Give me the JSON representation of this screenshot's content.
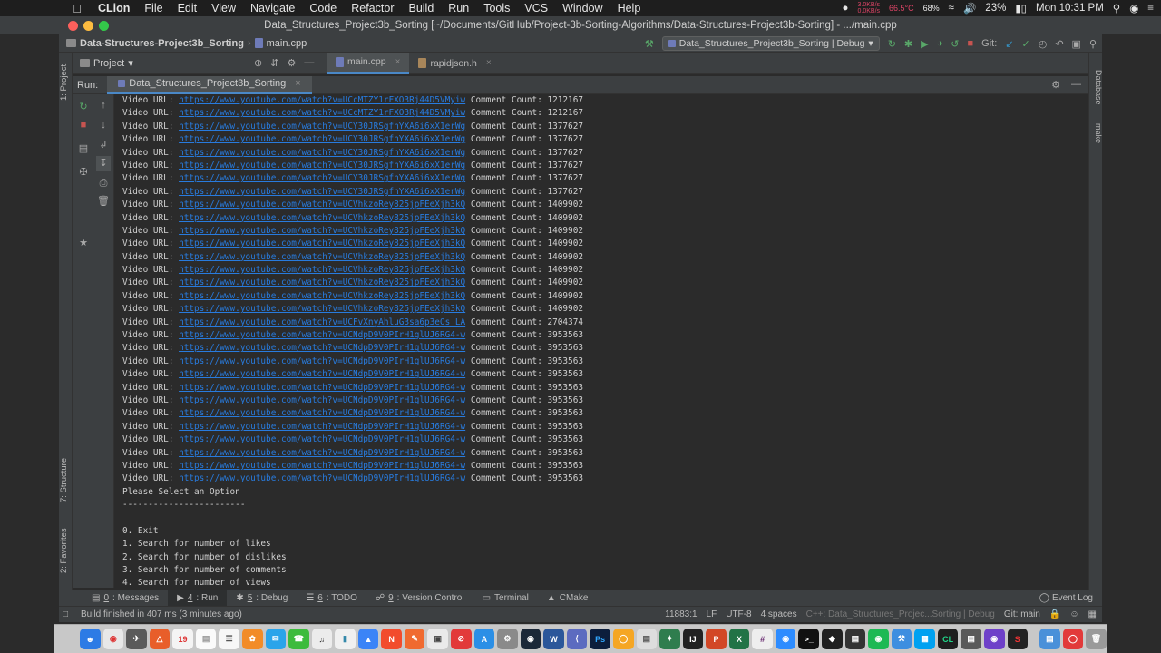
{
  "menubar": {
    "app": "CLion",
    "items": [
      "File",
      "Edit",
      "View",
      "Navigate",
      "Code",
      "Refactor",
      "Build",
      "Run",
      "Tools",
      "VCS",
      "Window",
      "Help"
    ],
    "net_tx": "3.0KB/s",
    "net_rx": "0.0KB/s",
    "cpu_temp": "66.5°C",
    "cpu_pct": "68%",
    "battery": "23%",
    "clock": "Mon 10:31 PM"
  },
  "window": {
    "title": "Data_Structures_Project3b_Sorting [~/Documents/GitHub/Project-3b-Sorting-Algorithms/Data-Structures-Project3b-Sorting] - .../main.cpp"
  },
  "navbar": {
    "project": "Data-Structures-Project3b_Sorting",
    "file": "main.cpp",
    "run_config": "Data_Structures_Project3b_Sorting | Debug",
    "git_label": "Git:"
  },
  "project_panel": {
    "label": "Project"
  },
  "editor_tabs": [
    {
      "label": "main.cpp",
      "active": true
    },
    {
      "label": "rapidjson.h",
      "active": false
    }
  ],
  "run_panel": {
    "label": "Run:",
    "tab": "Data_Structures_Project3b_Sorting"
  },
  "console": {
    "url_prefix": "Video URL: ",
    "count_prefix": " Comment Count: ",
    "rows": [
      {
        "url": "https://www.youtube.com/watch?v=UCcMTZY1rFXO3Rj44D5VMyiw",
        "count": "1212167"
      },
      {
        "url": "https://www.youtube.com/watch?v=UCcMTZY1rFXO3Rj44D5VMyiw",
        "count": "1212167"
      },
      {
        "url": "https://www.youtube.com/watch?v=UCY30JRSgfhYXA6i6xX1erWg",
        "count": "1377627"
      },
      {
        "url": "https://www.youtube.com/watch?v=UCY30JRSgfhYXA6i6xX1erWg",
        "count": "1377627"
      },
      {
        "url": "https://www.youtube.com/watch?v=UCY30JRSgfhYXA6i6xX1erWg",
        "count": "1377627"
      },
      {
        "url": "https://www.youtube.com/watch?v=UCY30JRSgfhYXA6i6xX1erWg",
        "count": "1377627"
      },
      {
        "url": "https://www.youtube.com/watch?v=UCY30JRSgfhYXA6i6xX1erWg",
        "count": "1377627"
      },
      {
        "url": "https://www.youtube.com/watch?v=UCY30JRSgfhYXA6i6xX1erWg",
        "count": "1377627"
      },
      {
        "url": "https://www.youtube.com/watch?v=UCVhkzoRey825jpFEeXjh3kQ",
        "count": "1409902"
      },
      {
        "url": "https://www.youtube.com/watch?v=UCVhkzoRey825jpFEeXjh3kQ",
        "count": "1409902"
      },
      {
        "url": "https://www.youtube.com/watch?v=UCVhkzoRey825jpFEeXjh3kQ",
        "count": "1409902"
      },
      {
        "url": "https://www.youtube.com/watch?v=UCVhkzoRey825jpFEeXjh3kQ",
        "count": "1409902"
      },
      {
        "url": "https://www.youtube.com/watch?v=UCVhkzoRey825jpFEeXjh3kQ",
        "count": "1409902"
      },
      {
        "url": "https://www.youtube.com/watch?v=UCVhkzoRey825jpFEeXjh3kQ",
        "count": "1409902"
      },
      {
        "url": "https://www.youtube.com/watch?v=UCVhkzoRey825jpFEeXjh3kQ",
        "count": "1409902"
      },
      {
        "url": "https://www.youtube.com/watch?v=UCVhkzoRey825jpFEeXjh3kQ",
        "count": "1409902"
      },
      {
        "url": "https://www.youtube.com/watch?v=UCVhkzoRey825jpFEeXjh3kQ",
        "count": "1409902"
      },
      {
        "url": "https://www.youtube.com/watch?v=UCFvXnyAhluG3sa6p3eOs_LA",
        "count": "2704374"
      },
      {
        "url": "https://www.youtube.com/watch?v=UCNdpD9V0PIrH1glUJ6RG4-w",
        "count": "3953563"
      },
      {
        "url": "https://www.youtube.com/watch?v=UCNdpD9V0PIrH1glUJ6RG4-w",
        "count": "3953563"
      },
      {
        "url": "https://www.youtube.com/watch?v=UCNdpD9V0PIrH1glUJ6RG4-w",
        "count": "3953563"
      },
      {
        "url": "https://www.youtube.com/watch?v=UCNdpD9V0PIrH1glUJ6RG4-w",
        "count": "3953563"
      },
      {
        "url": "https://www.youtube.com/watch?v=UCNdpD9V0PIrH1glUJ6RG4-w",
        "count": "3953563"
      },
      {
        "url": "https://www.youtube.com/watch?v=UCNdpD9V0PIrH1glUJ6RG4-w",
        "count": "3953563"
      },
      {
        "url": "https://www.youtube.com/watch?v=UCNdpD9V0PIrH1glUJ6RG4-w",
        "count": "3953563"
      },
      {
        "url": "https://www.youtube.com/watch?v=UCNdpD9V0PIrH1glUJ6RG4-w",
        "count": "3953563"
      },
      {
        "url": "https://www.youtube.com/watch?v=UCNdpD9V0PIrH1glUJ6RG4-w",
        "count": "3953563"
      },
      {
        "url": "https://www.youtube.com/watch?v=UCNdpD9V0PIrH1glUJ6RG4-w",
        "count": "3953563"
      },
      {
        "url": "https://www.youtube.com/watch?v=UCNdpD9V0PIrH1glUJ6RG4-w",
        "count": "3953563"
      },
      {
        "url": "https://www.youtube.com/watch?v=UCNdpD9V0PIrH1glUJ6RG4-w",
        "count": "3953563"
      }
    ],
    "menu_title": "Please Select an Option",
    "separator": "------------------------",
    "options": [
      "0. Exit",
      "1. Search for number of likes",
      "2. Search for number of dislikes",
      "3. Search for number of comments",
      "4. Search for number of views"
    ]
  },
  "bottom_tabs": [
    {
      "num": "0",
      "label": ": Messages",
      "icon": "messages-icon"
    },
    {
      "num": "4",
      "label": ": Run",
      "icon": "run-icon",
      "active": true
    },
    {
      "num": "5",
      "label": ": Debug",
      "icon": "debug-icon"
    },
    {
      "num": "6",
      "label": ": TODO",
      "icon": "todo-icon"
    },
    {
      "num": "9",
      "label": ": Version Control",
      "icon": "vcs-icon"
    },
    {
      "num": "",
      "label": "Terminal",
      "icon": "terminal-icon"
    },
    {
      "num": "",
      "label": "CMake",
      "icon": "cmake-icon"
    }
  ],
  "event_log": "Event Log",
  "status": {
    "message": "Build finished in 407 ms (3 minutes ago)",
    "position": "11883:1",
    "line_sep": "LF",
    "encoding": "UTF-8",
    "indent": "4 spaces",
    "context": "C++: Data_Structures_Projec...Sorting | Debug",
    "git_branch": "Git: main"
  },
  "side_tabs": {
    "left_top": "1: Project",
    "left_mid": "7: Structure",
    "left_bottom": "2: Favorites",
    "right_top": "Database",
    "right_mid": "make"
  },
  "colors": {
    "accent": "#4a88c7",
    "link": "#287bde",
    "run_green": "#59a869",
    "stop_red": "#c75450"
  }
}
